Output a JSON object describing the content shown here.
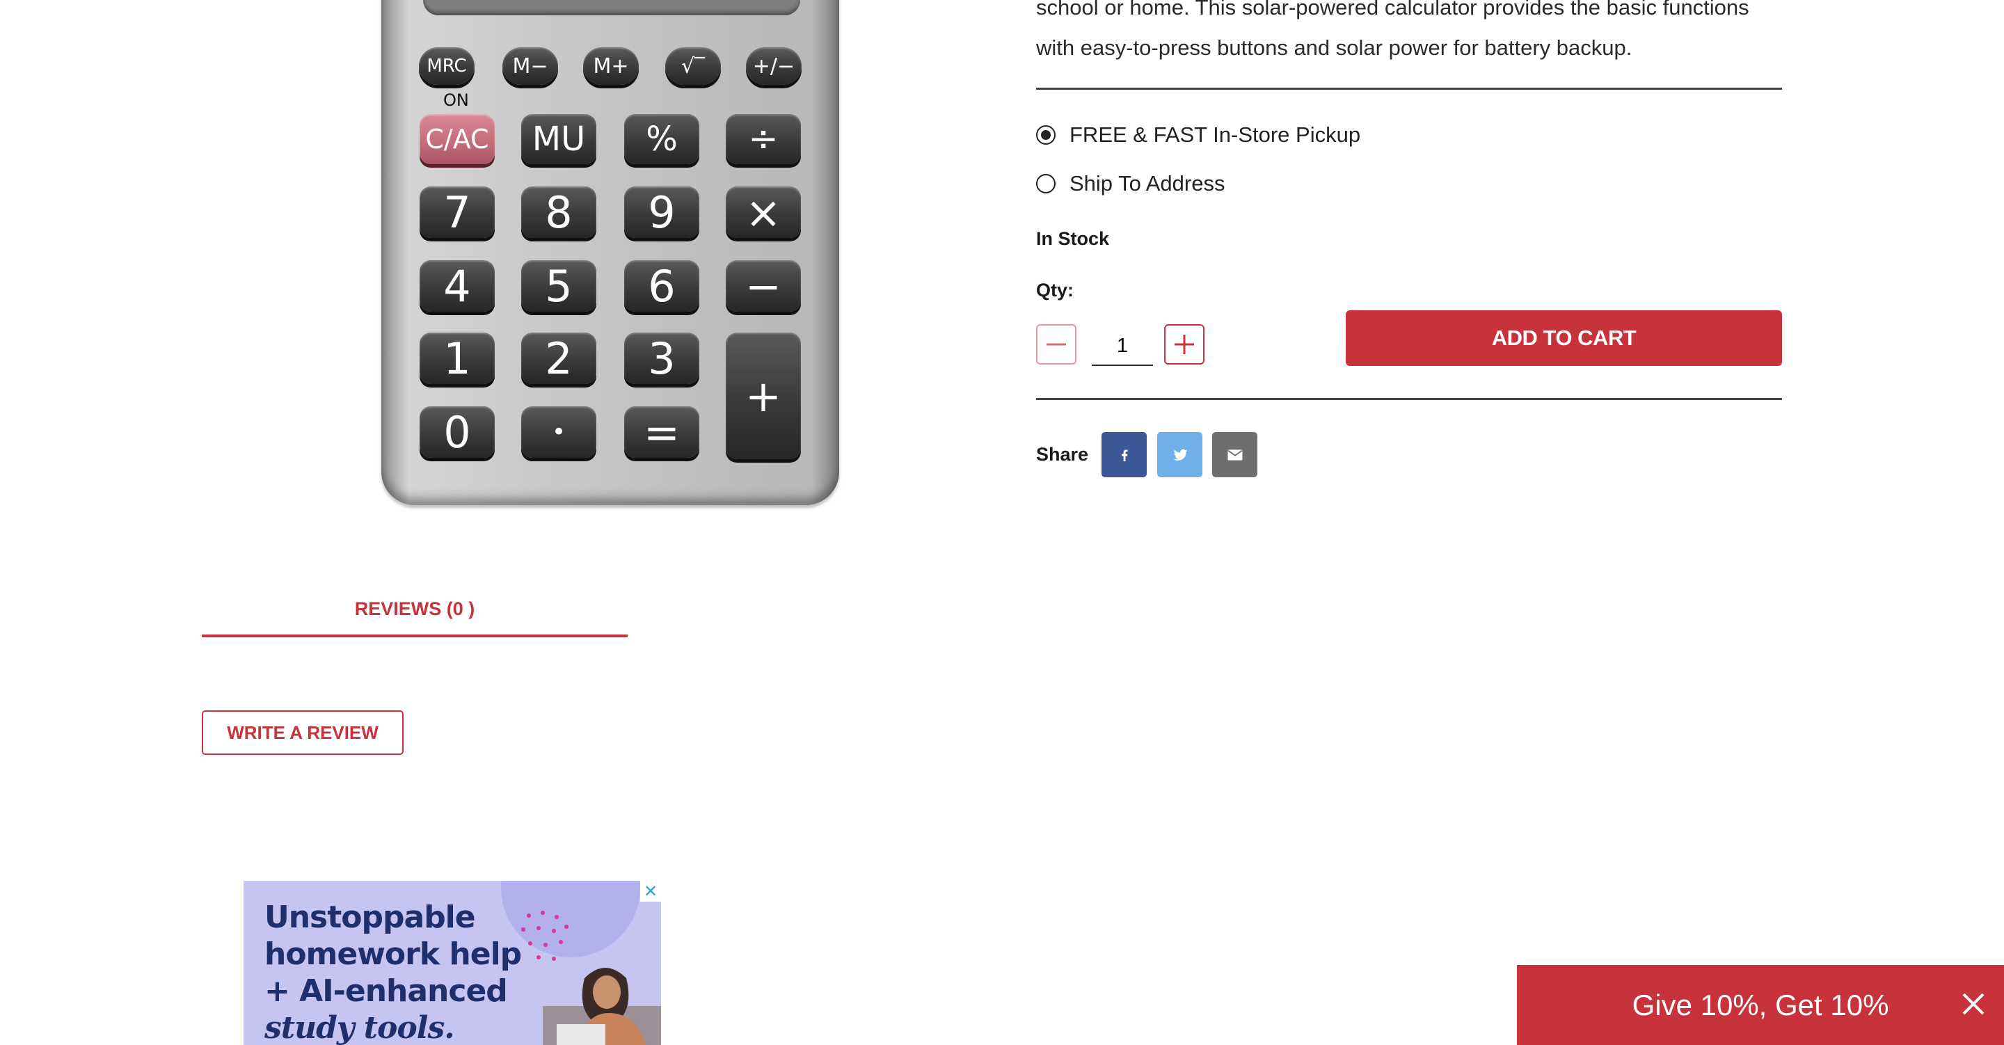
{
  "product": {
    "description_line1": "school or home. This solar-powered calculator provides the basic functions",
    "description_line2": "with easy-to-press buttons and solar power for battery backup."
  },
  "calculator_image": {
    "on_label": "ON",
    "function_keys": [
      "MRC",
      "M−",
      "M+",
      "√‾",
      "+/−"
    ],
    "keys": [
      "C/AC",
      "MU",
      "%",
      "÷",
      "7",
      "8",
      "9",
      "×",
      "4",
      "5",
      "6",
      "−",
      "1",
      "2",
      "3",
      "+",
      "0",
      "•",
      "="
    ]
  },
  "fulfillment": {
    "options": [
      {
        "label": "FREE & FAST In-Store Pickup",
        "selected": true
      },
      {
        "label": "Ship To Address",
        "selected": false
      }
    ]
  },
  "stock_status": "In Stock",
  "quantity": {
    "label": "Qty:",
    "value": "1"
  },
  "add_to_cart_label": "ADD TO CART",
  "share": {
    "label": "Share",
    "buttons": [
      {
        "name": "facebook",
        "icon": "facebook-icon",
        "color": "#3b5998"
      },
      {
        "name": "twitter",
        "icon": "twitter-icon",
        "color": "#6fb0ea"
      },
      {
        "name": "email",
        "icon": "email-icon",
        "color": "#6e6e6e"
      }
    ]
  },
  "reviews": {
    "tab_label": "REVIEWS (0 )",
    "write_review_label": "WRITE A REVIEW"
  },
  "ad": {
    "line1": "Unstoppable",
    "line2": "homework help",
    "line3": "+ AI-enhanced",
    "line4": "study tools.",
    "close_icon": "close-icon"
  },
  "promo": {
    "text": "Give 10%, Get 10%"
  },
  "colors": {
    "accent": "#c8323a"
  }
}
